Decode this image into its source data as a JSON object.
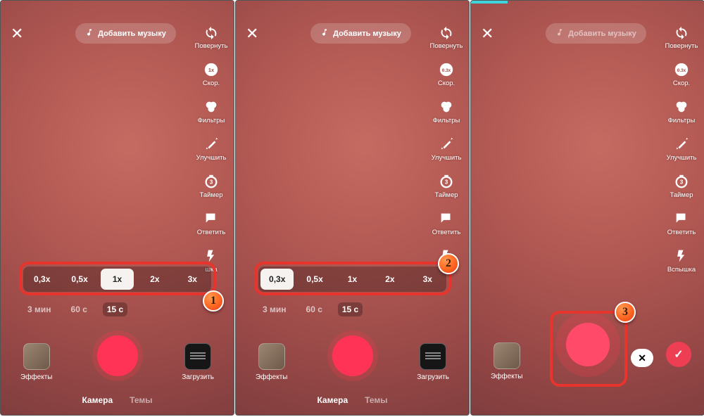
{
  "header": {
    "close_glyph": "✕",
    "music_label": "Добавить музыку"
  },
  "sidebar": {
    "flip": "Повернуть",
    "speed": "Скор.",
    "speed_badge": "0.3x",
    "filters": "Фильтры",
    "enhance": "Улучшить",
    "timer": "Таймер",
    "reply": "Ответить",
    "flash_short": "шка"
  },
  "sidebar3": {
    "flash_full": "Вспышка"
  },
  "speeds": [
    "0,3x",
    "0,5x",
    "1x",
    "2x",
    "3x"
  ],
  "durations": [
    "3 мин",
    "60 с",
    "15 с"
  ],
  "bottom": {
    "effects": "Эффекты",
    "upload": "Загрузить"
  },
  "modes": {
    "camera": "Камера",
    "themes": "Темы"
  },
  "callouts": {
    "step1": "1",
    "step2": "2",
    "step3": "3"
  },
  "cancel_glyph": "✕",
  "confirm_glyph": "✓"
}
